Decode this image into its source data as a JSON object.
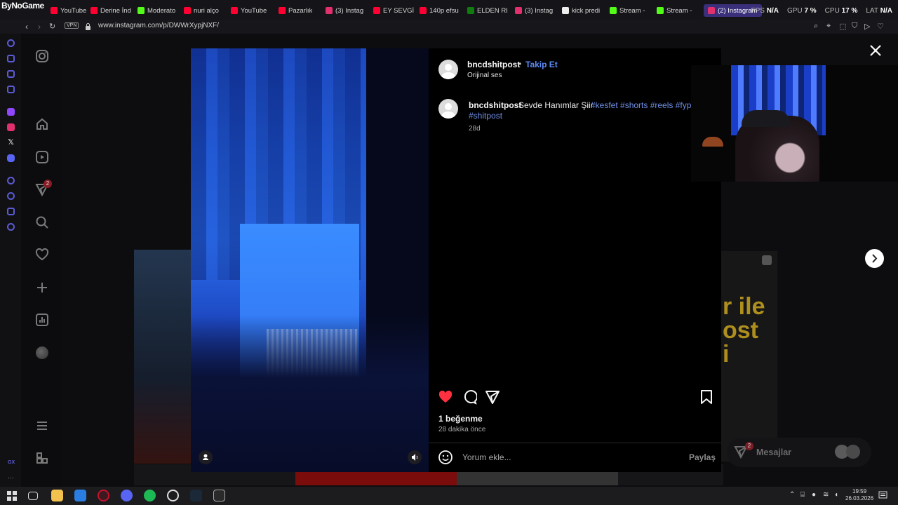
{
  "browser": {
    "logo_text": "ByNoGame",
    "tabs": [
      {
        "label": "YouTube",
        "color": "#ff0033"
      },
      {
        "label": "Derine İnd",
        "color": "#ff0033"
      },
      {
        "label": "Moderato",
        "color": "#53fc18"
      },
      {
        "label": "nuri alço",
        "color": "#ff0033"
      },
      {
        "label": "YouTube",
        "color": "#ff0033"
      },
      {
        "label": "Pazarlık",
        "color": "#ff0033"
      },
      {
        "label": "(3) Instag",
        "color": "#e1306c"
      },
      {
        "label": "EY SEVGİ",
        "color": "#ff0033"
      },
      {
        "label": "140p efsu",
        "color": "#ff0033"
      },
      {
        "label": "ELDEN RI",
        "color": "#107c10"
      },
      {
        "label": "(3) Instag",
        "color": "#e1306c"
      },
      {
        "label": "kick predi",
        "color": "#eeeeee"
      },
      {
        "label": "Stream -",
        "color": "#53fc18"
      },
      {
        "label": "Stream -",
        "color": "#53fc18"
      },
      {
        "label": "(2) Instagram",
        "color": "#e1306c",
        "active": true
      }
    ],
    "stats": {
      "fps_label": "FPS",
      "fps_value": "N/A",
      "gpu_label": "GPU",
      "gpu_value": "7 %",
      "cpu_label": "CPU",
      "cpu_value": "17 %",
      "lat_label": "LAT",
      "lat_value": "N/A"
    },
    "vpn_label": "VPN",
    "url": "www.instagram.com/p/DWWrXypjNXF/"
  },
  "post": {
    "username": "bncdshitpost",
    "separator": "•",
    "follow_label": "Takip Et",
    "audio_label": "Orijinal ses",
    "caption_user": "bncdshitpost",
    "caption_text": "Sevde Hanımlar Şiir",
    "caption_tags_line1": "#kesfet #shorts #reels #fyp",
    "caption_tags_line2": "#shitpost",
    "caption_age": "28d",
    "likes": "1 beğenme",
    "posted_ago": "28 dakika önce",
    "comment_placeholder": "Yorum ekle...",
    "share_label": "Paylaş"
  },
  "background": {
    "overlay_text_line1": "r ile",
    "overlay_text_line2": "ost",
    "overlay_text_line3": "i"
  },
  "messages": {
    "label": "Mesajlar",
    "badge": "2"
  },
  "sidebar_badge": "2",
  "taskbar": {
    "time": "19:59",
    "date": "26.03.2026"
  },
  "colors": {
    "accent": "#5b8cf7",
    "like": "#ff3040",
    "hashtag": "#6e8fe6"
  }
}
